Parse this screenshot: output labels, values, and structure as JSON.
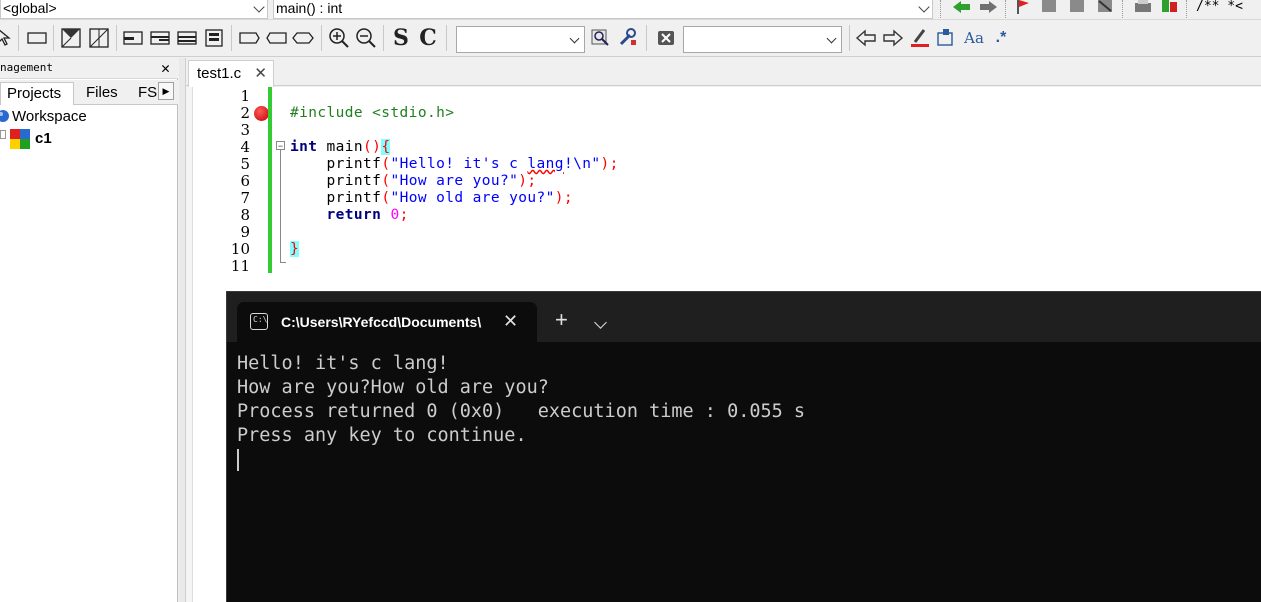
{
  "toolbar_top": {
    "scope_combo": "<global>",
    "function_combo": "main() : int",
    "comment_label": "/** *<"
  },
  "icons": [
    "arrow-left-icon",
    "arrow-right-icon",
    "flag-icon",
    "zoom-in-icon",
    "zoom-out-icon",
    "search-icon",
    "wrench-icon",
    "close-icon",
    "highlight-icon",
    "match-case-icon",
    "regex-icon"
  ],
  "toolbar2": {
    "s_label": "S",
    "c_label": "C",
    "case_label": "Aa",
    "regex_label": ".*"
  },
  "left_panel": {
    "title": "nagement",
    "close": "✕",
    "tabs": [
      "Projects",
      "Files",
      "FS"
    ],
    "tree": {
      "workspace": "Workspace",
      "project": "c1"
    }
  },
  "editor": {
    "tab_label": "test1.c",
    "tab_close": "✕",
    "line_numbers": [
      "1",
      "2",
      "3",
      "4",
      "5",
      "6",
      "7",
      "8",
      "9",
      "10",
      "11"
    ],
    "code": {
      "l2": "#include <stdio.h>",
      "l4_kw": "int",
      "l4_fn": " main",
      "l4_paren": "()",
      "l4_brace": "{",
      "l5_fn": "    printf",
      "l5_open": "(",
      "l5_str_a": "\"Hello! it's c ",
      "l5_str_b": "lang",
      "l5_str_c": "!\\n\"",
      "l5_close": ");",
      "l6_fn": "    printf",
      "l6_open": "(",
      "l6_str": "\"How are you?\"",
      "l6_close": ");",
      "l7_fn": "    printf",
      "l7_open": "(",
      "l7_str": "\"How old are you?\"",
      "l7_close": ");",
      "l8_kw": "    return",
      "l8_num": " 0",
      "l8_semi": ";",
      "l10": "}"
    }
  },
  "terminal": {
    "title": "C:\\Users\\RYefccd\\Documents\\",
    "close": "✕",
    "plus": "+",
    "lines": [
      "Hello! it's c lang!",
      "How are you?How old are you?",
      "Process returned 0 (0x0)   execution time : 0.055 s",
      "Press any key to continue."
    ]
  }
}
